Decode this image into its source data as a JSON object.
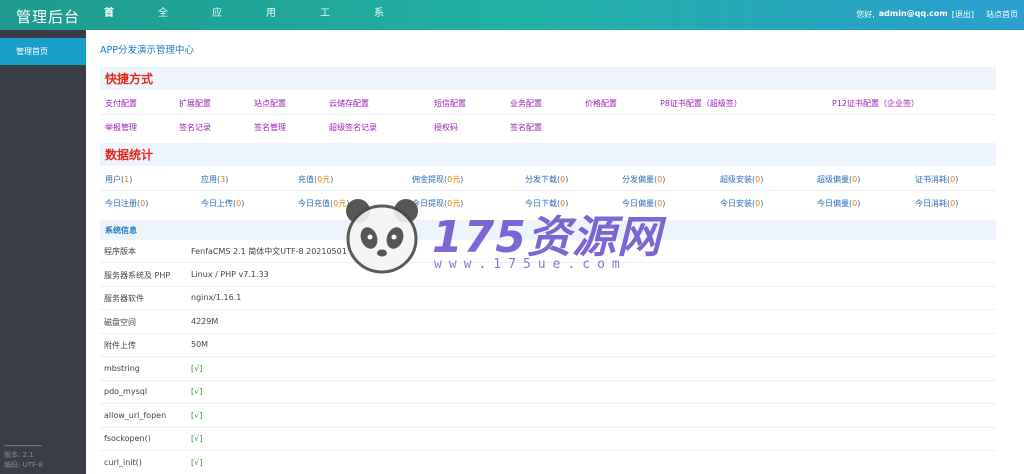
{
  "header": {
    "brand": "管理后台",
    "nav": [
      "首页",
      "全局",
      "应用",
      "用户",
      "工具",
      "系统"
    ],
    "greeting": "您好,",
    "username": "admin@qq.com",
    "logout": "[退出]",
    "site_home": "站点首页"
  },
  "sidebar": {
    "active_item": "管理首页",
    "separator": "------------------------",
    "version": "版本: 2.1",
    "encoding": "编码: UTF-8"
  },
  "main": {
    "title": "APP分发演示管理中心",
    "shortcuts_title": "快捷方式",
    "shortcuts_row1": [
      "支付配置",
      "扩展配置",
      "站点配置",
      "云储存配置",
      "短信配置",
      "业务配置",
      "价格配置",
      "P8证书配置（超级签）",
      "P12证书配置（企业签）"
    ],
    "shortcuts_row2": [
      "举报管理",
      "签名记录",
      "签名管理",
      "超级签名记录",
      "授权码",
      "签名配置"
    ],
    "stats_title": "数据统计",
    "stats_row1": [
      {
        "label": "用户",
        "value": "1"
      },
      {
        "label": "应用",
        "value": "3"
      },
      {
        "label": "充值",
        "value": "0元"
      },
      {
        "label": "佣金提现",
        "value": "0元"
      },
      {
        "label": "分发下载",
        "value": "0"
      },
      {
        "label": "分发偏量",
        "value": "0"
      },
      {
        "label": "超级安装",
        "value": "0"
      },
      {
        "label": "超级偏量",
        "value": "0"
      },
      {
        "label": "证书消耗",
        "value": "0"
      }
    ],
    "stats_row2": [
      {
        "label": "今日注册",
        "value": "0"
      },
      {
        "label": "今日上传",
        "value": "0"
      },
      {
        "label": "今日充值",
        "value": "0元"
      },
      {
        "label": "今日提现",
        "value": "0元"
      },
      {
        "label": "今日下载",
        "value": "0"
      },
      {
        "label": "今日偏量",
        "value": "0"
      },
      {
        "label": "今日安装",
        "value": "0"
      },
      {
        "label": "今日偏量",
        "value": "0"
      },
      {
        "label": "今日消耗",
        "value": "0"
      }
    ],
    "sysinfo_title": "系统信息",
    "sysinfo": [
      {
        "label": "程序版本",
        "value": "FenfaCMS 2.1 简体中文UTF-8 20210501"
      },
      {
        "label": "服务器系统及 PHP",
        "value": "Linux / PHP v7.1.33"
      },
      {
        "label": "服务器软件",
        "value": "nginx/1.16.1"
      },
      {
        "label": "磁盘空间",
        "value": "4229M"
      },
      {
        "label": "附件上传",
        "value": "50M"
      },
      {
        "label": "mbstring",
        "value": "[√]"
      },
      {
        "label": "pdo_mysql",
        "value": "[√]"
      },
      {
        "label": "allow_url_fopen",
        "value": "[√]"
      },
      {
        "label": "fsockopen()",
        "value": "[√]"
      },
      {
        "label": "curl_init()",
        "value": "[√]"
      }
    ]
  },
  "watermark": {
    "text": "175资源网",
    "url": "www.175ue.com"
  },
  "colors": {
    "topbar_start": "#1f9a8e",
    "topbar_end": "#2a9fd0",
    "sidebar_bg": "#3a3d45",
    "sidebar_active": "#1aa0c8",
    "section_title": "#e42a1d",
    "shortcut_link": "#9b1fb8",
    "stat_link": "#2a6db4",
    "stat_value": "#e07b00",
    "check_ok": "#2b9a2b"
  }
}
